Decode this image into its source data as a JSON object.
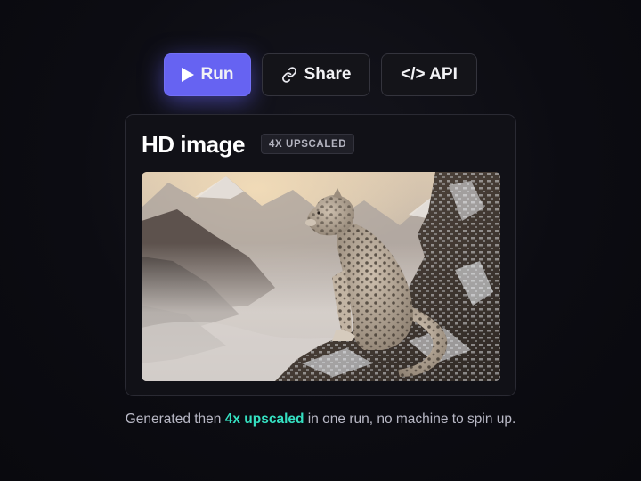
{
  "toolbar": {
    "run_label": "Run",
    "share_label": "Share",
    "api_label": "</> API",
    "run_icon": "play-icon",
    "share_icon": "link-icon",
    "accent_color": "#6663f2"
  },
  "card": {
    "title": "HD image",
    "badge": "4X UPSCALED",
    "image_subject": "snow-leopard-on-rocky-mountain-ledge"
  },
  "caption": {
    "before": "Generated then ",
    "highlight": "4x upscaled",
    "after": " in one run, no machine to spin up.",
    "highlight_color": "#35e0c1"
  }
}
